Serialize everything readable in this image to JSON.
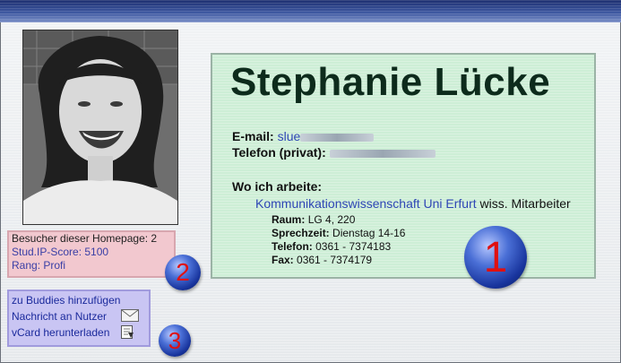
{
  "profile": {
    "name": "Stephanie Lücke",
    "email_label": "E-mail:",
    "email_visible": "slue",
    "phone_private_label": "Telefon (privat):",
    "work_heading": "Wo ich arbeite:",
    "institution_link": "Kommunikationswissenschaft Uni Erfurt",
    "position": "wiss. Mitarbeiter",
    "details": [
      {
        "label": "Raum:",
        "value": "LG 4, 220"
      },
      {
        "label": "Sprechzeit:",
        "value": "Dienstag 14-16"
      },
      {
        "label": "Telefon:",
        "value": "0361 - 7374183"
      },
      {
        "label": "Fax:",
        "value": "0361 - 7374179"
      }
    ]
  },
  "stats": {
    "visitors": "Besucher dieser Homepage: 2",
    "score": "Stud.IP-Score: 5100",
    "rank": "Rang: Profi"
  },
  "actions": {
    "add_buddy": "zu Buddies hinzufügen",
    "message": "Nachricht an Nutzer",
    "vcard": "vCard herunterladen"
  },
  "badges": {
    "one": "1",
    "two": "2",
    "three": "3"
  },
  "icons": {
    "message": "envelope-icon",
    "vcard": "vcard-download-icon"
  },
  "colors": {
    "link": "#2f46b5",
    "badge_digit": "#e01010",
    "card_bg": "#cdeed6",
    "stats_bg": "#f2c8cf",
    "actions_bg": "#c9c5f3"
  }
}
